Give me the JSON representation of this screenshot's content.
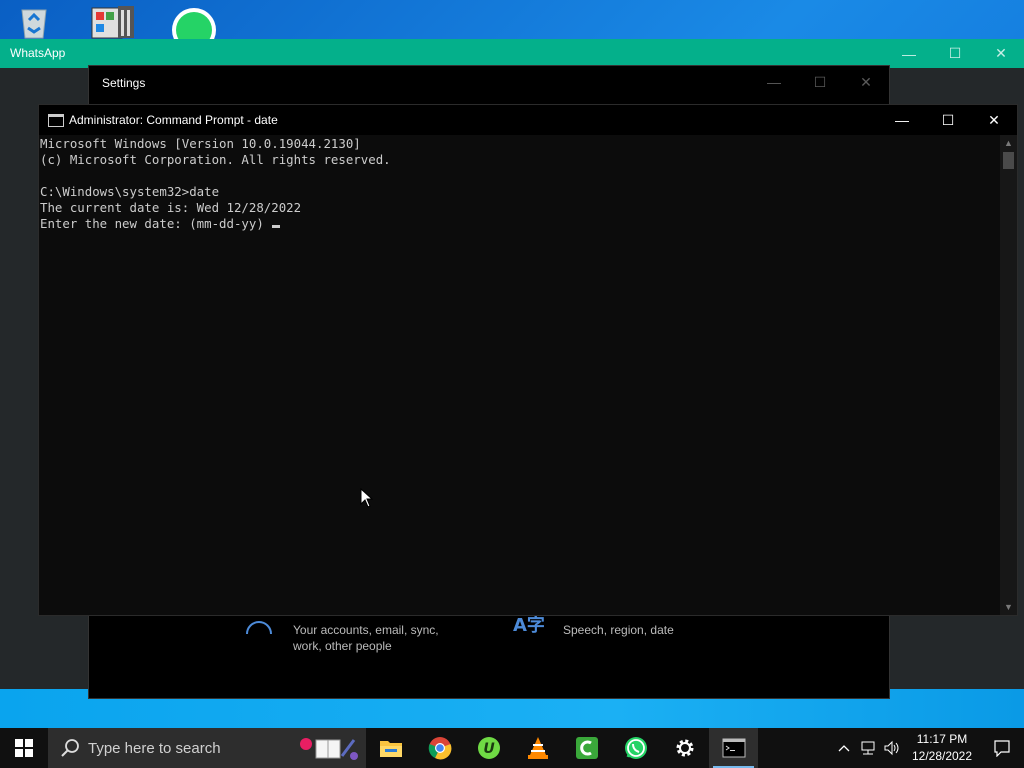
{
  "desktop": {
    "icons": [
      "recycle-bin-icon",
      "app-icon",
      "whatsapp-icon"
    ]
  },
  "whatsapp": {
    "title": "WhatsApp",
    "accent": "#04b08b",
    "controls": {
      "minimize": "—",
      "maximize": "☐",
      "close": "✕"
    }
  },
  "settings": {
    "title": "Settings",
    "controls": {
      "minimize": "—",
      "maximize": "☐",
      "close": "✕"
    },
    "items": [
      {
        "icon": "accounts-icon",
        "desc": "Your accounts, email, sync, work, other people"
      },
      {
        "icon": "time-language-icon",
        "glyph": "A字",
        "desc": "Speech, region, date"
      }
    ]
  },
  "cmd": {
    "title": "Administrator: Command Prompt - date",
    "controls": {
      "minimize": "—",
      "maximize": "☐",
      "close": "✕"
    },
    "lines": [
      "Microsoft Windows [Version 10.0.19044.2130]",
      "(c) Microsoft Corporation. All rights reserved.",
      "",
      "C:\\Windows\\system32>date",
      "The current date is: Wed 12/28/2022",
      "Enter the new date: (mm-dd-yy)"
    ]
  },
  "taskbar": {
    "search_placeholder": "Type here to search",
    "apps": [
      {
        "name": "file-explorer-icon",
        "active": false
      },
      {
        "name": "chrome-icon",
        "active": false
      },
      {
        "name": "upwork-icon",
        "active": false
      },
      {
        "name": "vlc-icon",
        "active": false
      },
      {
        "name": "camtasia-icon",
        "active": false
      },
      {
        "name": "whatsapp-icon",
        "active": false
      },
      {
        "name": "settings-icon",
        "active": false
      },
      {
        "name": "command-prompt-icon",
        "active": true
      }
    ],
    "clock": {
      "time": "11:17 PM",
      "date": "12/28/2022"
    }
  }
}
